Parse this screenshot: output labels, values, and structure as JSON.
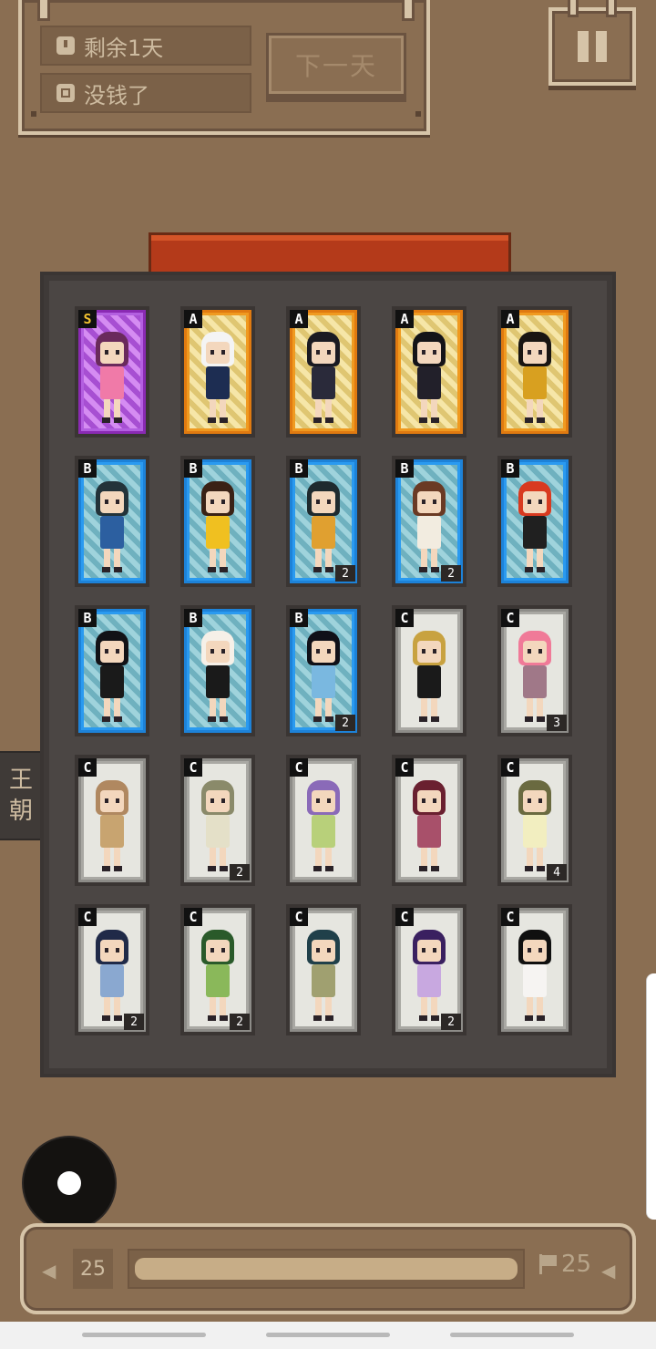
{
  "status": {
    "days_left": "剩余1天",
    "money": "没钱了",
    "next_day_label": "下一天"
  },
  "side_tab": {
    "line1": "王",
    "line2": "朝"
  },
  "cards": [
    {
      "grade": "S",
      "count": "",
      "hair": "#6a2a5c",
      "outfit": "#f07aa8"
    },
    {
      "grade": "A",
      "count": "",
      "hair": "#f4f4f4",
      "outfit": "#1d2d52"
    },
    {
      "grade": "A",
      "count": "",
      "hair": "#1a1a22",
      "outfit": "#2a2a3a"
    },
    {
      "grade": "A",
      "count": "",
      "hair": "#141418",
      "outfit": "#22202a"
    },
    {
      "grade": "A",
      "count": "",
      "hair": "#191512",
      "outfit": "#d8a020"
    },
    {
      "grade": "B",
      "count": "",
      "hair": "#23333a",
      "outfit": "#2c5fa0"
    },
    {
      "grade": "B",
      "count": "",
      "hair": "#3a2216",
      "outfit": "#f0c020"
    },
    {
      "grade": "B",
      "count": "2",
      "hair": "#1e2a2e",
      "outfit": "#e0a030"
    },
    {
      "grade": "B",
      "count": "2",
      "hair": "#6a3a24",
      "outfit": "#f2ece0"
    },
    {
      "grade": "B",
      "count": "",
      "hair": "#d83a20",
      "outfit": "#202020"
    },
    {
      "grade": "B",
      "count": "",
      "hair": "#121216",
      "outfit": "#1a1a1a"
    },
    {
      "grade": "B",
      "count": "",
      "hair": "#f6f0e8",
      "outfit": "#1a1a1a"
    },
    {
      "grade": "B",
      "count": "2",
      "hair": "#101018",
      "outfit": "#7ab8e0"
    },
    {
      "grade": "C",
      "count": "",
      "hair": "#c8a240",
      "outfit": "#1a1a1a"
    },
    {
      "grade": "C",
      "count": "3",
      "hair": "#f07a98",
      "outfit": "#a07888"
    },
    {
      "grade": "C",
      "count": "",
      "hair": "#b08860",
      "outfit": "#c8a470"
    },
    {
      "grade": "C",
      "count": "2",
      "hair": "#8a8a6a",
      "outfit": "#e4e0c8"
    },
    {
      "grade": "C",
      "count": "",
      "hair": "#8a6ab8",
      "outfit": "#b8d07a"
    },
    {
      "grade": "C",
      "count": "",
      "hair": "#6a2030",
      "outfit": "#a8506a"
    },
    {
      "grade": "C",
      "count": "4",
      "hair": "#6a6a40",
      "outfit": "#f2eec0"
    },
    {
      "grade": "C",
      "count": "2",
      "hair": "#202a48",
      "outfit": "#8aa8d0"
    },
    {
      "grade": "C",
      "count": "2",
      "hair": "#2a5a2a",
      "outfit": "#8ab85a"
    },
    {
      "grade": "C",
      "count": "",
      "hair": "#20404a",
      "outfit": "#a0a070"
    },
    {
      "grade": "C",
      "count": "2",
      "hair": "#3a2060",
      "outfit": "#c8a8e0"
    },
    {
      "grade": "C",
      "count": "",
      "hair": "#101010",
      "outfit": "#f6f4f2"
    }
  ],
  "bottom": {
    "current_day": "25",
    "goal_day": "25",
    "progress": 1.0
  },
  "colors": {
    "background": "#8a6e52",
    "panel": "#4b4644",
    "grade_S": "#8a2ab3",
    "grade_A": "#e07a10",
    "grade_B": "#1d82d8",
    "grade_C": "#8d8c88"
  }
}
